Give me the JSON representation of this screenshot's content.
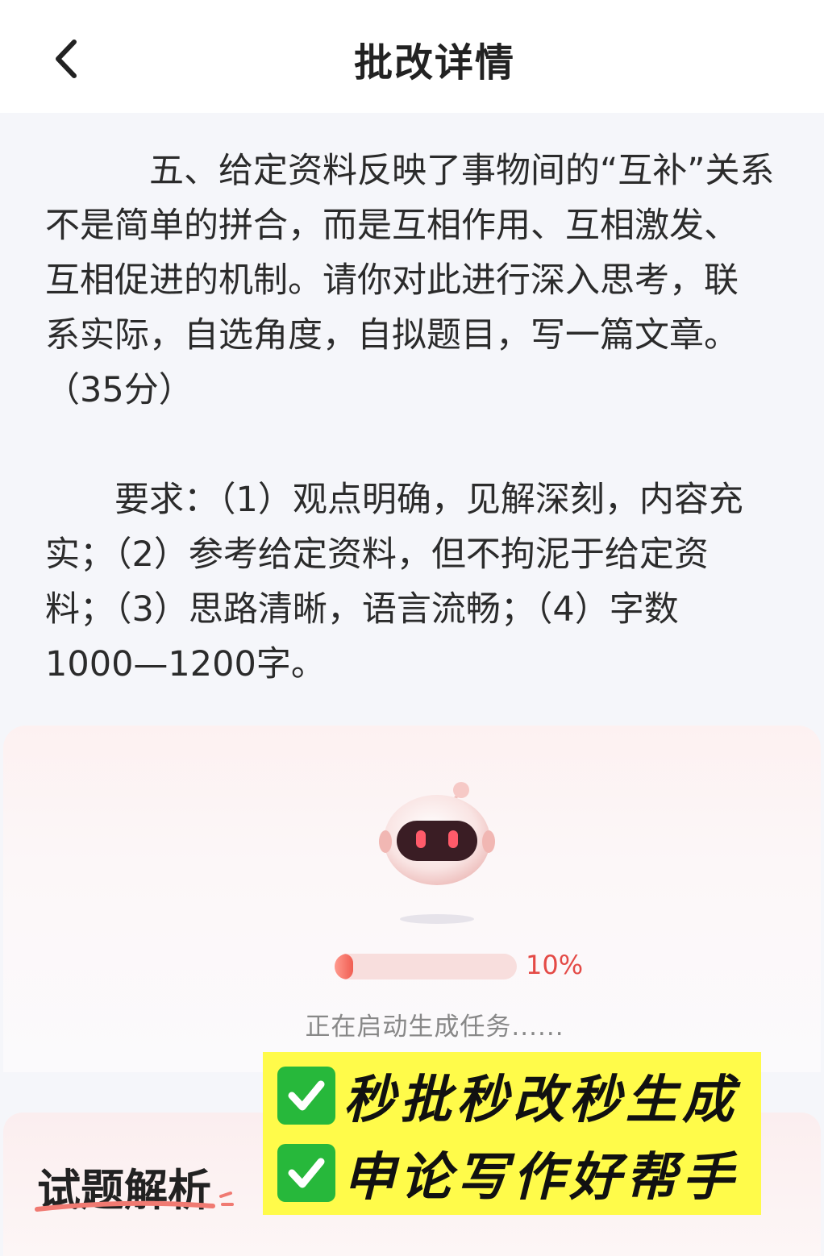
{
  "header": {
    "title": "批改详情"
  },
  "question": {
    "lines": [
      "　　　五、给定资料反映了事物间的“互补”关系",
      "不是简单的拼合，而是互相作用、互相激发、",
      "互相促进的机制。请你对此进行深入思考，联",
      "系实际，自选角度，自拟题目，写一篇文章。",
      "（35分）"
    ],
    "requirements": [
      "　　要求：（1）观点明确，见解深刻，内容充",
      "实；（2）参考给定资料，但不拘泥于给定资",
      "料；（3）思路清晰，语言流畅；（4）字数",
      "1000—1200字。"
    ]
  },
  "progress": {
    "percent_label": "10%",
    "value": 0.1,
    "status": "正在启动生成任务......"
  },
  "analysis": {
    "title": "试题解析"
  },
  "promo": {
    "line1": "秒批秒改秒生成",
    "line2": "申论写作好帮手"
  },
  "colors": {
    "accent": "#e44a46",
    "promo_bg": "#fffb4a",
    "check_green": "#27b83b"
  }
}
